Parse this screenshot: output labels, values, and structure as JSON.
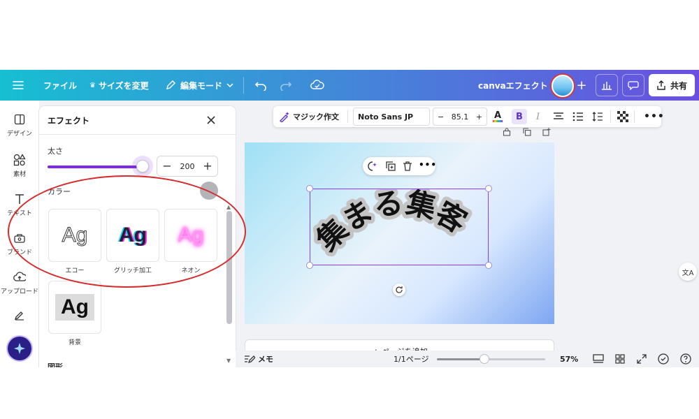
{
  "topbar": {
    "menu_icon": "hamburger-icon",
    "file_label": "ファイル",
    "resize_label": "サイズを変更",
    "edit_mode_label": "編集モード",
    "doc_title": "canvaエフェクト",
    "share_label": "共有"
  },
  "rail": {
    "items": [
      {
        "label": "デザイン",
        "icon": "layout-icon"
      },
      {
        "label": "素材",
        "icon": "shapes-icon"
      },
      {
        "label": "テキスト",
        "icon": "text-icon"
      },
      {
        "label": "ブランド",
        "icon": "brand-icon"
      },
      {
        "label": "アップロード",
        "icon": "upload-icon"
      }
    ]
  },
  "panel": {
    "title": "エフェクト",
    "thickness_label": "太さ",
    "thickness_value": "200",
    "thickness_fraction": 1.0,
    "color_label": "カラー",
    "color_value": "#b4b4b8",
    "effects": [
      {
        "preview": "Ag",
        "label": "エコー"
      },
      {
        "preview": "Ag",
        "label": "グリッチ加工"
      },
      {
        "preview": "Ag",
        "label": "ネオン"
      },
      {
        "preview": "Ag",
        "label": "背景"
      }
    ],
    "next_section": "図形"
  },
  "toolbar": {
    "magic_write": "マジック作文",
    "font": "Noto Sans JP",
    "font_size": "85.1",
    "minus": "−",
    "plus": "+",
    "bold": "B",
    "italic": "I"
  },
  "canvas": {
    "text": "集まる集客",
    "add_page": "+ ページを追加"
  },
  "bottombar": {
    "notes": "メモ",
    "page_indicator": "1/1ページ",
    "zoom": "57%",
    "zoom_fraction": 0.4
  },
  "colors": {
    "accent": "#7d2ae8",
    "annotation": "#d72b2b"
  }
}
